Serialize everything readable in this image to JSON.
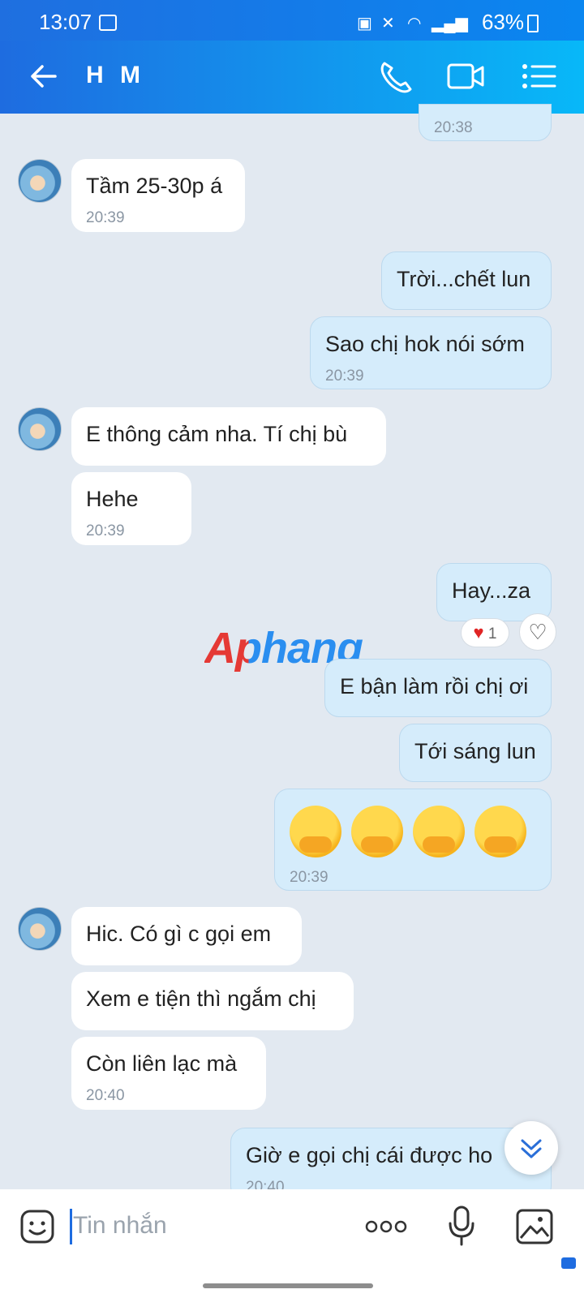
{
  "status_bar": {
    "time": "13:07",
    "battery": "63%"
  },
  "header": {
    "title": "H M"
  },
  "messages": [
    {
      "text": "",
      "time": "20:38"
    },
    {
      "text": "Tầm 25-30p á",
      "time": "20:39"
    },
    {
      "text": "Trời...chết lun"
    },
    {
      "text": "Sao chị hok nói sớm",
      "time": "20:39"
    },
    {
      "text": "E thông cảm nha. Tí chị bù"
    },
    {
      "text": "Hehe",
      "time": "20:39"
    },
    {
      "text": "Hay...za",
      "reaction_count": "1"
    },
    {
      "text": "E bận làm rồi chị ơi"
    },
    {
      "text": "Tới sáng lun"
    },
    {
      "text": "",
      "time": "20:39"
    },
    {
      "text": "Hic. Có gì c gọi em"
    },
    {
      "text": "Xem e tiện thì ngắm chị"
    },
    {
      "text": "Còn liên lạc mà",
      "time": "20:40"
    },
    {
      "text": "Giờ e gọi chị cái được ho",
      "time": "20:40"
    }
  ],
  "watermark": "Aphang",
  "input": {
    "placeholder": "Tin nhắn"
  },
  "icons": {
    "back": "back-arrow-icon",
    "call": "phone-icon",
    "video": "video-call-icon",
    "menu": "list-menu-icon",
    "sticker": "sticker-icon",
    "more": "more-dots-icon",
    "mic": "microphone-icon",
    "gallery": "image-icon",
    "scroll": "chevron-down-icon"
  },
  "colors": {
    "header_start": "#1e6ce0",
    "header_end": "#08b8f8",
    "outgoing_bubble": "#d5ecfb",
    "incoming_bubble": "#ffffff",
    "background": "#e2e9f1"
  }
}
